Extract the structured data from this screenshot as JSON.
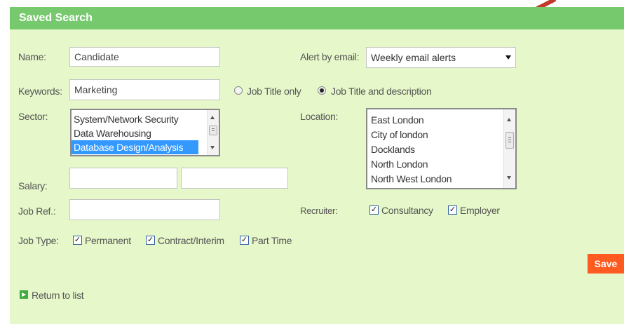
{
  "header": {
    "title": "Saved Search"
  },
  "form": {
    "name": {
      "label": "Name:",
      "value": "Candidate"
    },
    "alert": {
      "label": "Alert by email:",
      "selected": "Weekly email alerts"
    },
    "keywords": {
      "label": "Keywords:",
      "value": "Marketing"
    },
    "scope": {
      "option1": "Job Title only",
      "option2": "Job Title and description",
      "selected": "Job Title and description"
    },
    "sector": {
      "label": "Sector:",
      "options": [
        "System/Network Security",
        "Data Warehousing",
        "Database Design/Analysis"
      ],
      "selected": "Database Design/Analysis"
    },
    "location": {
      "label": "Location:",
      "options": [
        "East London",
        "City of london",
        "Docklands",
        "North London",
        "North West London"
      ]
    },
    "salary": {
      "label": "Salary:",
      "min": "",
      "max": ""
    },
    "jobref": {
      "label": "Job Ref.:",
      "value": ""
    },
    "recruiter": {
      "label": "Recruiter:",
      "options": [
        {
          "label": "Consultancy",
          "checked": true
        },
        {
          "label": "Employer",
          "checked": true
        }
      ]
    },
    "jobtype": {
      "label": "Job Type:",
      "options": [
        {
          "label": "Permanent",
          "checked": true
        },
        {
          "label": "Contract/Interim",
          "checked": true
        },
        {
          "label": "Part Time",
          "checked": true
        }
      ]
    }
  },
  "actions": {
    "save": "Save",
    "return": "Return to list"
  },
  "colors": {
    "header": "#77c96e",
    "panel": "#e6f7c9",
    "save": "#ff5a1f",
    "annotation_arrow": "#c0392b",
    "selection": "#3399ff"
  }
}
